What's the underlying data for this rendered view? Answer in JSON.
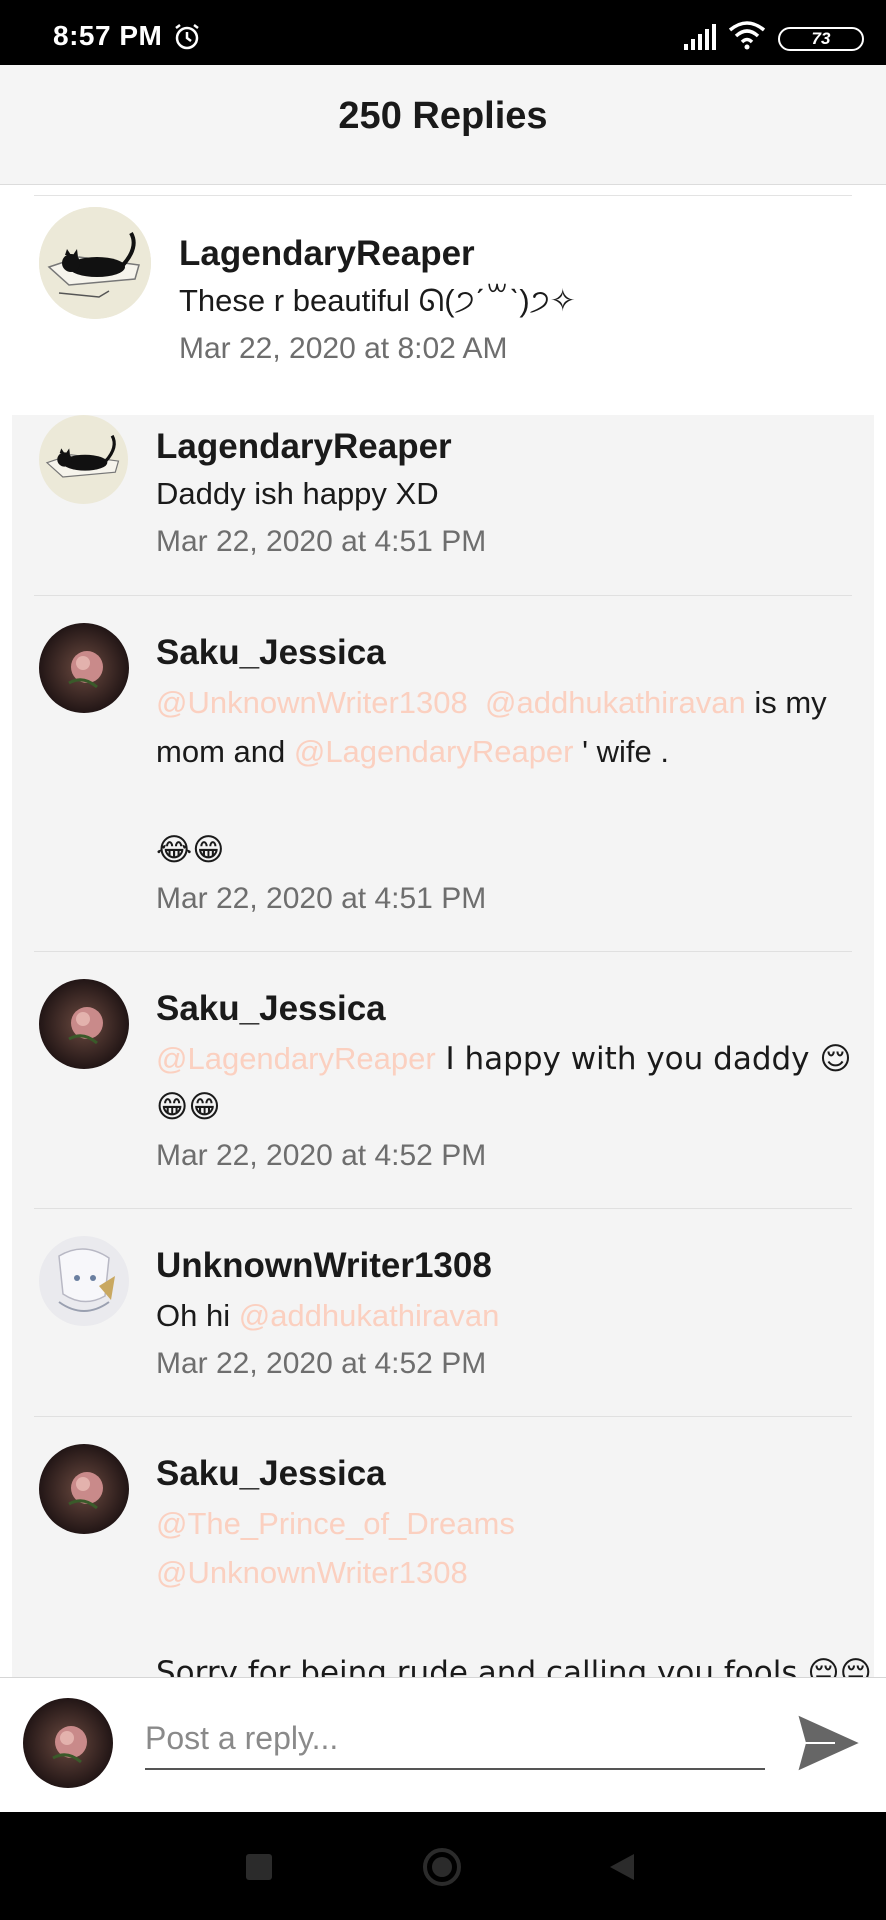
{
  "status_bar": {
    "time": "8:57 PM",
    "battery": "73"
  },
  "header": {
    "title": "250 Replies"
  },
  "parent_comment": {
    "author": "LagendaryReaper",
    "text": "These r beautiful ᘏ(੭ˊ꒳ˋ)੭✧",
    "time": "Mar 22, 2020 at 8:02 AM"
  },
  "replies": [
    {
      "author": "LagendaryReaper",
      "text": "Daddy ish happy XD",
      "time": "Mar 22, 2020 at 4:51 PM"
    },
    {
      "author": "Saku_Jessica",
      "mention_1": "@UnknownWriter1308",
      "mention_2": "@addhukathiravan",
      "text_1": " is my",
      "text_2": "mom and ",
      "mention_3": "@LagendaryReaper",
      "text_3": " ' wife .",
      "emojis": "😂😁",
      "time": "Mar 22, 2020 at 4:51 PM"
    },
    {
      "author": "Saku_Jessica",
      "mention_1": "@LagendaryReaper",
      "text_1": "  I happy with you daddy 😌",
      "emojis": "😁😁",
      "time": "Mar 22, 2020 at 4:52 PM"
    },
    {
      "author": "UnknownWriter1308",
      "text_1": "Oh hi ",
      "mention_1": "@addhukathiravan",
      "time": "Mar 22, 2020 at 4:52 PM"
    },
    {
      "author": "Saku_Jessica",
      "mention_1": "@The_Prince_of_Dreams",
      "mention_2": "@UnknownWriter1308",
      "text_1": "Sorry for being rude and calling you fools 😔😔"
    }
  ],
  "composer": {
    "placeholder": "Post a reply..."
  },
  "colors": {
    "mention": "#fbd0c0",
    "header_bg": "#f5f5f5",
    "replies_bg": "#f4f4f4"
  }
}
